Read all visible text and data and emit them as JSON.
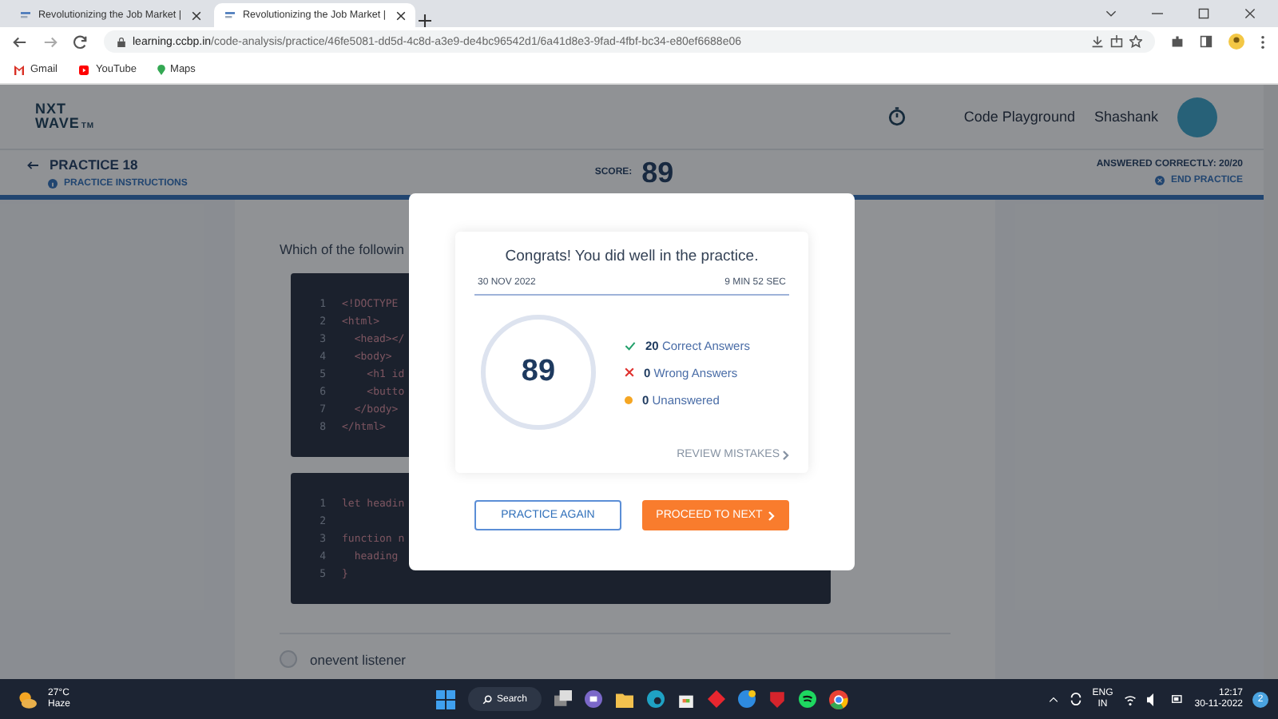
{
  "browser": {
    "tabs": [
      {
        "title": "Revolutionizing the Job Market |",
        "selected": false
      },
      {
        "title": "Revolutionizing the Job Market |",
        "selected": true
      }
    ],
    "url_host": "learning.ccbp.in",
    "url_path": "/code-analysis/practice/46fe5081-dd5d-4c8d-a3e9-de4bc96542d1/6a41d8e3-9fad-4fbf-bc34-e80ef6688e06",
    "bookmarks": [
      "Gmail",
      "YouTube",
      "Maps"
    ]
  },
  "header": {
    "logo_top": "NXT",
    "logo_bottom": "WAVE",
    "logo_mark": "TM",
    "playground": "Code Playground",
    "user": "Shashank"
  },
  "practice_bar": {
    "title": "PRACTICE 18",
    "instructions": "PRACTICE INSTRUCTIONS",
    "score_label": "SCORE:",
    "score": "89",
    "answered": "ANSWERED CORRECTLY: 20/20",
    "end": "END PRACTICE"
  },
  "question": "Which of the followin",
  "code_blocks": [
    {
      "lines": [
        {
          "number": "1",
          "text": "<!DOCTYPE"
        },
        {
          "number": "2",
          "text": "<html>"
        },
        {
          "number": "3",
          "text": "  <head></"
        },
        {
          "number": "4",
          "text": "  <body>"
        },
        {
          "number": "5",
          "text": "    <h1 id"
        },
        {
          "number": "6",
          "text": "    <butto"
        },
        {
          "number": "7",
          "text": "  </body>"
        },
        {
          "number": "8",
          "text": "</html>"
        }
      ]
    },
    {
      "lines": [
        {
          "number": "1",
          "text": "let headin"
        },
        {
          "number": "2"
        },
        {
          "number": "3",
          "text": "function n"
        },
        {
          "number": "4",
          "text": "  heading"
        },
        {
          "number": "5",
          "text": "}"
        }
      ]
    }
  ],
  "option": {
    "label": "onevent listener",
    "selected": false
  },
  "modal": {
    "heading": "Congrats! You did well in the practice.",
    "date": "30 NOV 2022",
    "duration": "9 MIN 52 SEC",
    "score": "89",
    "stats": [
      {
        "kind": "correct",
        "count": "20",
        "label": "Correct Answers"
      },
      {
        "kind": "wrong",
        "count": "0",
        "label": "Wrong Answers"
      },
      {
        "kind": "unanswered",
        "count": "0",
        "label": "Unanswered"
      }
    ],
    "review": "REVIEW MISTAKES",
    "buttons": [
      {
        "kind": "outline",
        "label": "PRACTICE AGAIN"
      },
      {
        "kind": "primary",
        "label": "PROCEED TO NEXT"
      }
    ]
  },
  "taskbar": {
    "temperature": "27°C",
    "weather": "Haze",
    "search": "Search",
    "language": "ENG",
    "region": "IN",
    "time": "12:17",
    "date": "30-11-2022",
    "notifications": "2"
  }
}
